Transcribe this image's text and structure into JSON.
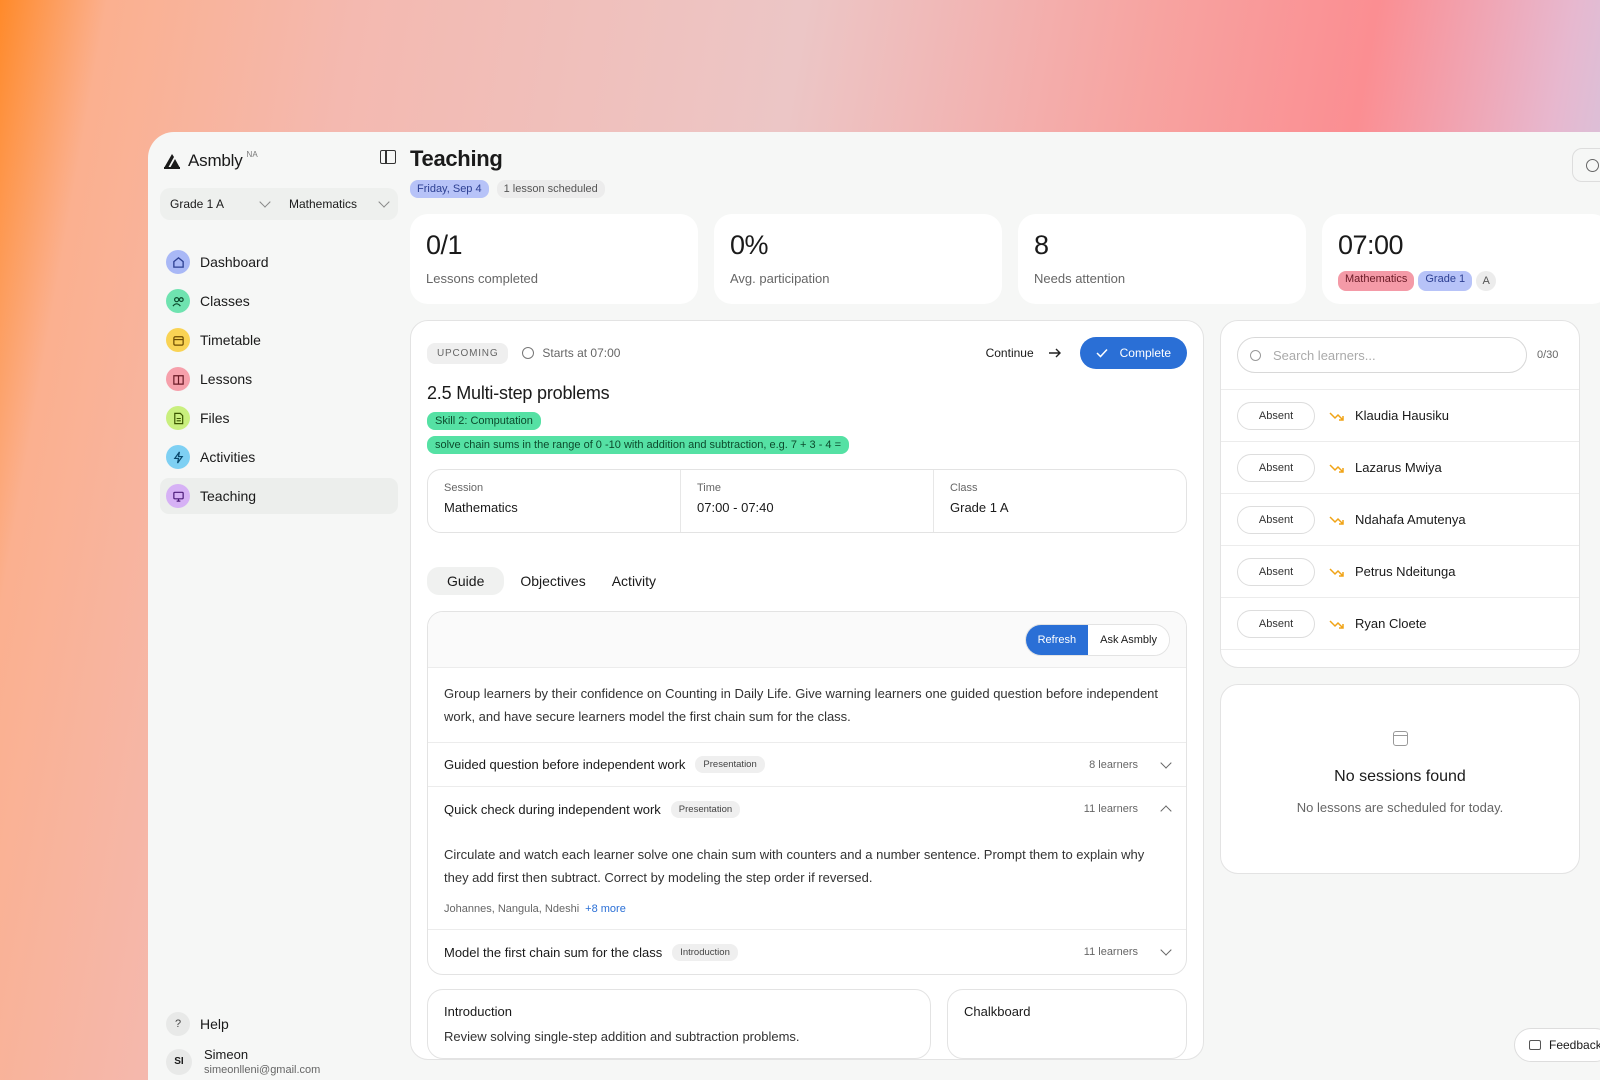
{
  "brand": {
    "name": "Asmbly",
    "sup": "NA"
  },
  "selectors": {
    "grade": "Grade 1 A",
    "subject": "Mathematics"
  },
  "nav": [
    {
      "label": "Dashboard",
      "icon": "home-icon",
      "color": "#a9b8f6"
    },
    {
      "label": "Classes",
      "icon": "users-icon",
      "color": "#6fe3b0"
    },
    {
      "label": "Timetable",
      "icon": "calendar-icon",
      "color": "#f9d354"
    },
    {
      "label": "Lessons",
      "icon": "book-icon",
      "color": "#f6a0ab"
    },
    {
      "label": "Files",
      "icon": "file-icon",
      "color": "#c9ef7e"
    },
    {
      "label": "Activities",
      "icon": "bolt-icon",
      "color": "#7ed0f3"
    },
    {
      "label": "Teaching",
      "icon": "presentation-icon",
      "color": "#d6b1f5"
    }
  ],
  "help_label": "Help",
  "user": {
    "initials": "SI",
    "name": "Simeon",
    "email": "simeonlleni@gmail.com"
  },
  "page": {
    "title": "Teaching",
    "date": "Friday, Sep 4",
    "scheduled": "1 lesson scheduled"
  },
  "stats": [
    {
      "value": "0/1",
      "label": "Lessons completed"
    },
    {
      "value": "0%",
      "label": "Avg. participation"
    },
    {
      "value": "8",
      "label": "Needs attention"
    }
  ],
  "next_stat": {
    "value": "07:00",
    "tags": [
      "Mathematics",
      "Grade 1",
      "A"
    ]
  },
  "lesson": {
    "status": "UPCOMING",
    "starts": "Starts at 07:00",
    "continue_label": "Continue",
    "complete_label": "Complete",
    "title": "2.5 Multi-step problems",
    "skill": "Skill 2: Computation",
    "objective": "solve chain sums in the range of 0 -10 with addition and subtraction, e.g. 7 + 3 - 4 =",
    "info": [
      {
        "label": "Session",
        "value": "Mathematics"
      },
      {
        "label": "Time",
        "value": "07:00 - 07:40"
      },
      {
        "label": "Class",
        "value": "Grade 1 A"
      }
    ],
    "tabs": [
      "Guide",
      "Objectives",
      "Activity"
    ]
  },
  "guide": {
    "refresh_label": "Refresh",
    "ask_label": "Ask Asmbly",
    "summary": "Group learners by their confidence on Counting in Daily Life. Give warning learners one guided question before independent work, and have secure learners model the first chain sum for the class.",
    "rows": [
      {
        "title": "Guided question before independent work",
        "tag": "Presentation",
        "count": "8 learners"
      },
      {
        "title": "Quick check during independent work",
        "tag": "Presentation",
        "count": "11 learners"
      },
      {
        "title": "Model the first chain sum for the class",
        "tag": "Introduction",
        "count": "11 learners"
      }
    ],
    "expanded_text": "Circulate and watch each learner solve one chain sum with counters and a number sentence. Prompt them to explain why they add first then subtract. Correct by modeling the step order if reversed.",
    "expanded_names": "Johannes, Nangula, Ndeshi",
    "expanded_more": "+8 more"
  },
  "intro_card": {
    "title": "Introduction",
    "text": "Review solving single-step addition and subtraction problems."
  },
  "chalk_card": {
    "title": "Chalkboard"
  },
  "learners": {
    "search_placeholder": "Search learners...",
    "count": "0/30",
    "status_label": "Absent",
    "list": [
      "Klaudia Hausiku",
      "Lazarus Mwiya",
      "Ndahafa Amutenya",
      "Petrus Ndeitunga",
      "Ryan Cloete"
    ]
  },
  "sessions": {
    "title": "No sessions found",
    "subtitle": "No lessons are scheduled for today."
  },
  "feedback_label": "Feedback"
}
